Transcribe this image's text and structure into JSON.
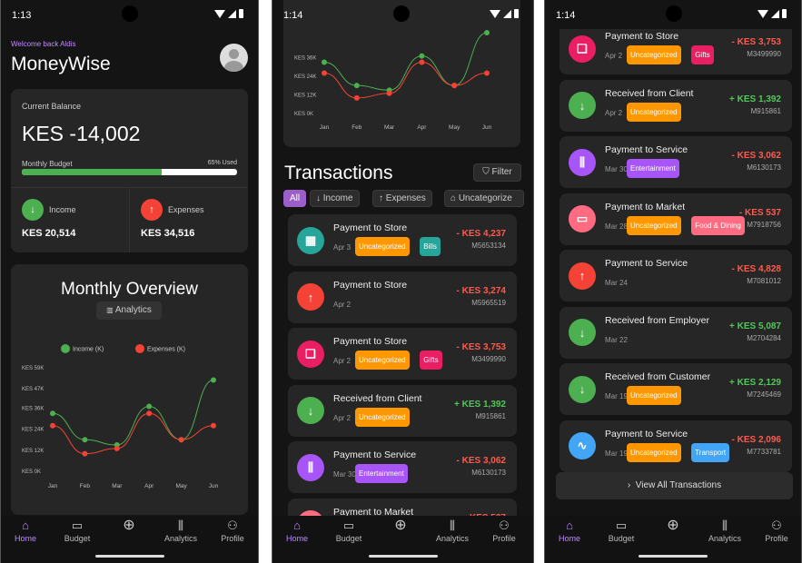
{
  "screens": [
    {
      "time": "1:13"
    },
    {
      "time": "1:14"
    },
    {
      "time": "1:14"
    }
  ],
  "home": {
    "welcome": "Welcome back Aldis",
    "app_title": "MoneyWise",
    "balance_label": "Current Balance",
    "balance_value": "KES -14,002",
    "budget_label": "Monthly Budget",
    "budget_used": "65% Used",
    "budget_fraction": 0.65,
    "income_label": "Income",
    "income_value": "KES 20,514",
    "expenses_label": "Expenses",
    "expenses_value": "KES 34,516"
  },
  "overview": {
    "title": "Monthly Overview",
    "analytics_button": "Analytics"
  },
  "chart_data": {
    "type": "line",
    "categories": [
      "Jan",
      "Feb",
      "Mar",
      "Apr",
      "May",
      "Jun"
    ],
    "series": [
      {
        "name": "Income (K)",
        "color": "#4caf50",
        "values": [
          33,
          18,
          15,
          37,
          18,
          52
        ]
      },
      {
        "name": "Expenses (K)",
        "color": "#f44336",
        "values": [
          26,
          10,
          13,
          33,
          18,
          26
        ]
      }
    ],
    "y_ticks": [
      "KES 0K",
      "KES 12K",
      "KES 24K",
      "KES 36K",
      "KES 47K",
      "KES 59K"
    ],
    "y_tick_values": [
      0,
      12,
      24,
      36,
      47,
      59
    ],
    "ylim": [
      0,
      59
    ],
    "legend": "top",
    "grid": false
  },
  "transactions_screen": {
    "title": "Transactions",
    "filter_button": "Filter",
    "chips": [
      "All",
      "Income",
      "Expenses",
      "Uncategorize"
    ],
    "view_all": "View All Transactions",
    "mini_chart_ticks": [
      "KES 36K",
      "KES 24K",
      "KES 12K",
      "KES 0K"
    ]
  },
  "transactions": [
    {
      "title": "Payment to Store",
      "date": "Apr 3",
      "amount": "- KES 4,237",
      "ref": "M5653134",
      "type": "debit",
      "color": "#26a69a",
      "icon": "grid-icon",
      "tags": [
        {
          "label": "Uncategorized",
          "color": "#ff9800"
        },
        {
          "label": "Bills",
          "color": "#26a69a"
        }
      ]
    },
    {
      "title": "Payment to Store",
      "date": "Apr 2",
      "amount": "- KES 3,274",
      "ref": "M5965519",
      "type": "debit",
      "color": "#f44336",
      "icon": "arrow-up-icon",
      "tags": []
    },
    {
      "title": "Payment to Store",
      "date": "Apr 2",
      "amount": "- KES 3,753",
      "ref": "M3499990",
      "type": "debit",
      "color": "#e91e63",
      "icon": "bookmark-icon",
      "tags": [
        {
          "label": "Uncategorized",
          "color": "#ff9800"
        },
        {
          "label": "Gifts",
          "color": "#e91e63"
        }
      ]
    },
    {
      "title": "Received from Client",
      "date": "Apr 2",
      "amount": "+ KES 1,392",
      "ref": "M915861",
      "type": "credit",
      "color": "#4caf50",
      "icon": "arrow-down-icon",
      "tags": [
        {
          "label": "Uncategorized",
          "color": "#ff9800"
        }
      ]
    },
    {
      "title": "Payment to Service",
      "date": "Mar 30",
      "amount": "- KES 3,062",
      "ref": "M6130173",
      "type": "debit",
      "color": "#a855f7",
      "icon": "bar-chart-icon",
      "tags": [
        {
          "label": "Entertainment",
          "color": "#a855f7"
        }
      ]
    },
    {
      "title": "Payment to Market",
      "date": "Mar 28",
      "amount": "- KES 537",
      "ref": "M7918756",
      "type": "debit",
      "color": "#ff6b81",
      "icon": "card-icon",
      "tags": [
        {
          "label": "Uncategorized",
          "color": "#ff9800"
        },
        {
          "label": "Food & Dining",
          "color": "#ff6b81"
        }
      ]
    },
    {
      "title": "Payment to Service",
      "date": "Mar 24",
      "amount": "- KES 4,828",
      "ref": "M7081012",
      "type": "debit",
      "color": "#f44336",
      "icon": "arrow-up-icon",
      "tags": []
    },
    {
      "title": "Received from Employer",
      "date": "Mar 22",
      "amount": "+ KES 5,087",
      "ref": "M2704284",
      "type": "credit",
      "color": "#4caf50",
      "icon": "arrow-down-icon",
      "tags": []
    },
    {
      "title": "Received from Customer",
      "date": "Mar 19",
      "amount": "+ KES 2,129",
      "ref": "M7245469",
      "type": "credit",
      "color": "#4caf50",
      "icon": "arrow-down-icon",
      "tags": [
        {
          "label": "Uncategorized",
          "color": "#ff9800"
        }
      ]
    },
    {
      "title": "Payment to Service",
      "date": "Mar 19",
      "amount": "- KES 2,096",
      "ref": "M7733781",
      "type": "debit",
      "color": "#42a5f5",
      "icon": "pulse-icon",
      "tags": [
        {
          "label": "Uncategorized",
          "color": "#ff9800"
        },
        {
          "label": "Transport",
          "color": "#42a5f5"
        }
      ]
    }
  ],
  "nav": {
    "items": [
      {
        "label": "Home",
        "icon": "home-icon"
      },
      {
        "label": "Budget",
        "icon": "wallet-icon"
      },
      {
        "label": "",
        "icon": "add-icon"
      },
      {
        "label": "Analytics",
        "icon": "analytics-icon"
      },
      {
        "label": "Profile",
        "icon": "profile-icon"
      }
    ]
  }
}
